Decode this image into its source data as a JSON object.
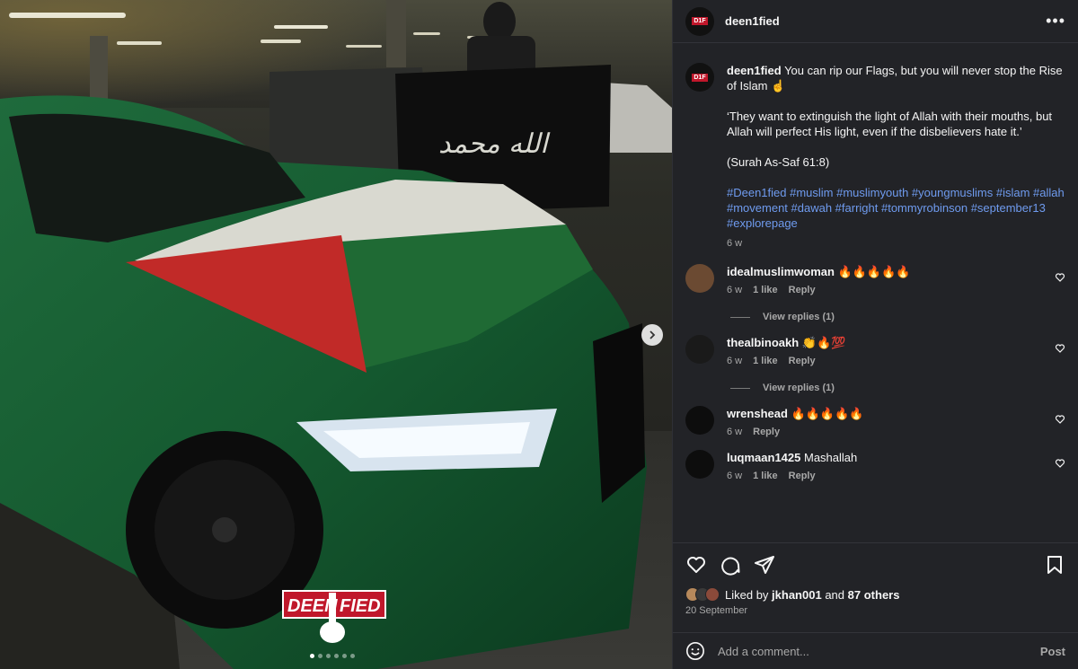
{
  "post": {
    "username": "deen1fied",
    "more_label": "•••",
    "caption_lead": "You can rip our Flags, but you will never stop the Rise of Islam ☝",
    "caption_quote": "‘They want to extinguish the light of Allah with their mouths, but Allah will perfect His light, even if the disbelievers hate it.’",
    "caption_ref": "(Surah As-Saf 61:8)",
    "hashtags": "#Deen1fied #muslim #muslimyouth #youngmuslims #islam #allah #movement #dawah #farright #tommyrobinson #september13 #explorepage",
    "age": "6 w",
    "watermark": "DEEN FIED",
    "carousel": {
      "count": 6,
      "active": 0
    }
  },
  "comments": [
    {
      "user": "idealmuslimwoman",
      "text": "🔥🔥🔥🔥🔥",
      "age": "6 w",
      "likes": "1 like",
      "reply": "Reply",
      "replies": "View replies (1)",
      "avatar_color": "#6b4a32"
    },
    {
      "user": "thealbinoakh",
      "text": "👏🔥💯",
      "age": "6 w",
      "likes": "1 like",
      "reply": "Reply",
      "replies": "View replies (1)",
      "avatar_color": "#1a1a1a"
    },
    {
      "user": "wrenshead",
      "text": "🔥🔥🔥🔥🔥",
      "age": "6 w",
      "reply": "Reply",
      "avatar_color": "#0d0d0d"
    },
    {
      "user": "luqmaan1425",
      "text": "Mashallah",
      "age": "6 w",
      "likes": "1 like",
      "reply": "Reply",
      "avatar_color": "#0d0d0d"
    }
  ],
  "likes": {
    "prefix": "Liked by",
    "user": "jkhan001",
    "conj": "and",
    "others": "87 others",
    "date": "20 September"
  },
  "add_comment": {
    "placeholder": "Add a comment...",
    "post_label": "Post"
  },
  "icons": [
    "more-icon",
    "next-arrow-icon",
    "heart-icon",
    "comment-icon",
    "share-icon",
    "save-icon",
    "emoji-icon"
  ],
  "colors": {
    "panel_bg": "#222327",
    "link": "#6f9bef",
    "muted": "#a8a8a8",
    "text": "#f5f5f5"
  }
}
